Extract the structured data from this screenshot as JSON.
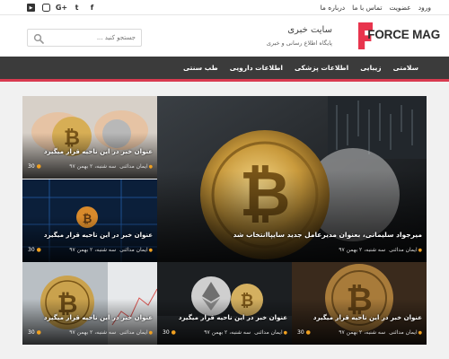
{
  "topbar": {
    "nav": [
      "ورود",
      "عضویت",
      "تماس با ما",
      "درباره ما"
    ],
    "social": [
      {
        "icon": "facebook-icon",
        "glyph": "f"
      },
      {
        "icon": "google-plus-icon",
        "glyph": "G+"
      },
      {
        "icon": "twitter-icon",
        "glyph": "t"
      },
      {
        "icon": "instagram-icon",
        "glyph": "◎"
      },
      {
        "icon": "youtube-icon",
        "glyph": "▶"
      }
    ]
  },
  "header": {
    "logo_text": "FORCE MAG",
    "site_name": "سایت خبری",
    "tagline": "پایگاه اطلاع رسانی و خبری",
    "search_placeholder": "جستجو کنید ..."
  },
  "nav": {
    "items": [
      "سلامتی",
      "زیبایی",
      "اطلاعات پزشکی",
      "اطلاعات دارویی",
      "طب سنتی"
    ]
  },
  "colors": {
    "brand": "#e8344d",
    "nav_bg": "#3b3b3b",
    "nav_accent": "#d93a4f",
    "meta_icon": "#f0a020"
  },
  "posts": [
    {
      "title": "میرجواد سلیمانی، بعنوان مدیرعامل جدید سایپاانتخاب شد",
      "author": "ایمان مدائنی",
      "date": "سه شنبه، ۲ بهمن ۹۷",
      "views": "30"
    },
    {
      "title": "عنوان خبر در این ناحیه قرار میگیرد",
      "author": "ایمان مدائنی",
      "date": "سه شنبه، ۲ بهمن ۹۷",
      "views": "30"
    },
    {
      "title": "عنوان خبر در این ناحیه قرار میگیرد",
      "author": "ایمان مدائنی",
      "date": "سه شنبه، ۲ بهمن ۹۷",
      "views": "30"
    },
    {
      "title": "عنوان خبر در این ناحیه قرار میگیرد",
      "author": "ایمان مدائنی",
      "date": "سه شنبه، ۲ بهمن ۹۷",
      "views": "30"
    },
    {
      "title": "عنوان خبر در این ناحیه قرار میگیرد",
      "author": "ایمان مدائنی",
      "date": "سه شنبه، ۲ بهمن ۹۷",
      "views": "30"
    },
    {
      "title": "عنوان خبر در این ناحیه قرار میگیرد",
      "author": "ایمان مدائنی",
      "date": "سه شنبه، ۲ بهمن ۹۷",
      "views": "30"
    }
  ]
}
